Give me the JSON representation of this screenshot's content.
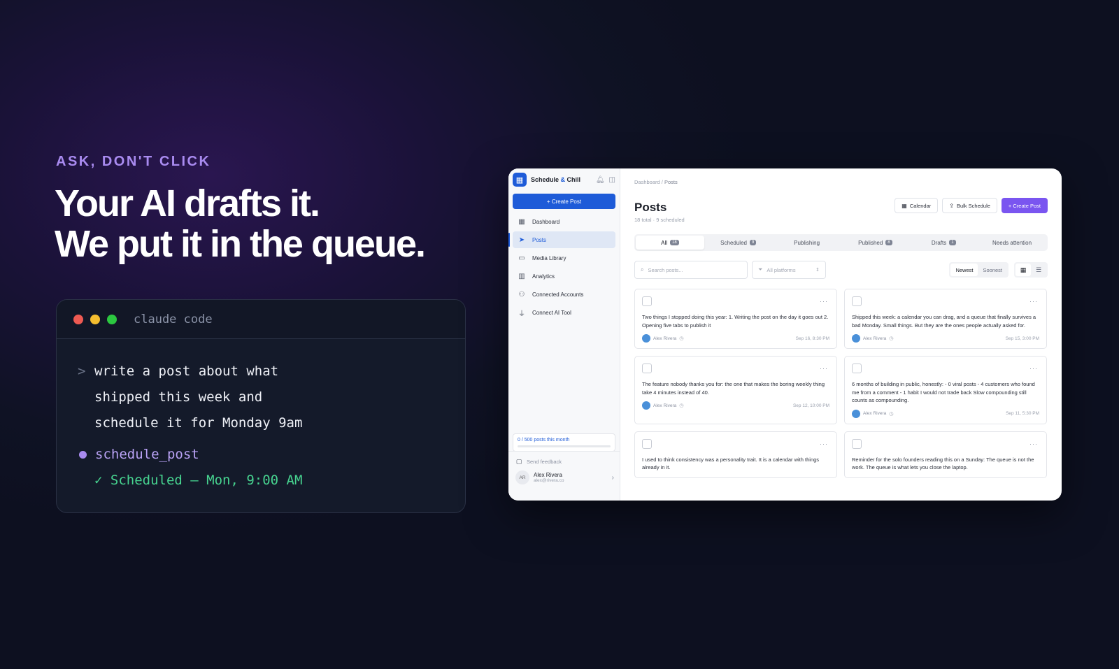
{
  "hero": {
    "eyebrow": "ASK, DON'T CLICK",
    "headline_line1": "Your AI drafts it.",
    "headline_line2": "We put it in the queue."
  },
  "terminal": {
    "title": "claude code",
    "prompt_symbol": ">",
    "prompt": "write a post about what shipped this week and schedule it for Monday 9am",
    "tool_name": "schedule_post",
    "result": "✓ Scheduled — Mon, 9:00 AM",
    "colors": {
      "tool": "#b9a2f5",
      "result": "#47d490"
    }
  },
  "app": {
    "brand": {
      "name_part1": "Schedule ",
      "name_amp": "&",
      "name_part2": " Chill"
    },
    "sidebar": {
      "create_label": "+ Create Post",
      "items": [
        {
          "label": "Dashboard",
          "icon": "dashboard-icon"
        },
        {
          "label": "Posts",
          "icon": "send-icon",
          "active": true
        },
        {
          "label": "Media Library",
          "icon": "folder-icon"
        },
        {
          "label": "Analytics",
          "icon": "chart-icon"
        },
        {
          "label": "Connected Accounts",
          "icon": "users-icon"
        },
        {
          "label": "Connect AI Tool",
          "icon": "plug-icon"
        }
      ],
      "usage_text": "0 / 500 posts this month",
      "usage_fraction": 0,
      "feedback_label": "Send feedback",
      "user": {
        "initials": "AR",
        "name": "Alex Rivera",
        "email": "alex@rivera.co"
      }
    },
    "breadcrumb": {
      "parent": "Dashboard",
      "sep": " / ",
      "current": "Posts"
    },
    "page_title": "Posts",
    "subtitle": "18 total · 9 scheduled",
    "actions": {
      "calendar": "Calendar",
      "bulk": "Bulk Schedule",
      "create": "+ Create Post"
    },
    "tabs": [
      {
        "label": "All",
        "count": "18"
      },
      {
        "label": "Scheduled",
        "count": "9"
      },
      {
        "label": "Publishing",
        "count": ""
      },
      {
        "label": "Published",
        "count": "8"
      },
      {
        "label": "Drafts",
        "count": "1"
      },
      {
        "label": "Needs attention",
        "count": ""
      }
    ],
    "search_placeholder": "Search posts...",
    "platform_filter": "All platforms",
    "sort": {
      "newest": "Newest",
      "soonest": "Soonest"
    },
    "accent_color": "#7a55f0",
    "brand_color": "#1e5bd8",
    "posts": [
      {
        "text": "Two things I stopped doing this year: 1. Writing the post on the day it goes out 2. Opening five tabs to publish it",
        "author": "Alex Rivera",
        "date": "Sep 16, 8:30 PM"
      },
      {
        "text": "Shipped this week: a calendar you can drag, and a queue that finally survives a bad Monday. Small things. But they are the ones people actually asked for.",
        "author": "Alex Rivera",
        "date": "Sep 15, 3:00 PM"
      },
      {
        "text": "The feature nobody thanks you for: the one that makes the boring weekly thing take 4 minutes instead of 40.",
        "author": "Alex Rivera",
        "date": "Sep 12, 10:00 PM"
      },
      {
        "text": "6 months of building in public, honestly: - 0 viral posts - 4 customers who found me from a comment - 1 habit I would not trade back Slow compounding still counts as compounding.",
        "author": "Alex Rivera",
        "date": "Sep 11, 5:30 PM"
      },
      {
        "text": "I used to think consistency was a personality trait. It is a calendar with things already in it.",
        "author": "",
        "date": ""
      },
      {
        "text": "Reminder for the solo founders reading this on a Sunday: The queue is not the work. The queue is what lets you close the laptop.",
        "author": "",
        "date": ""
      }
    ]
  }
}
